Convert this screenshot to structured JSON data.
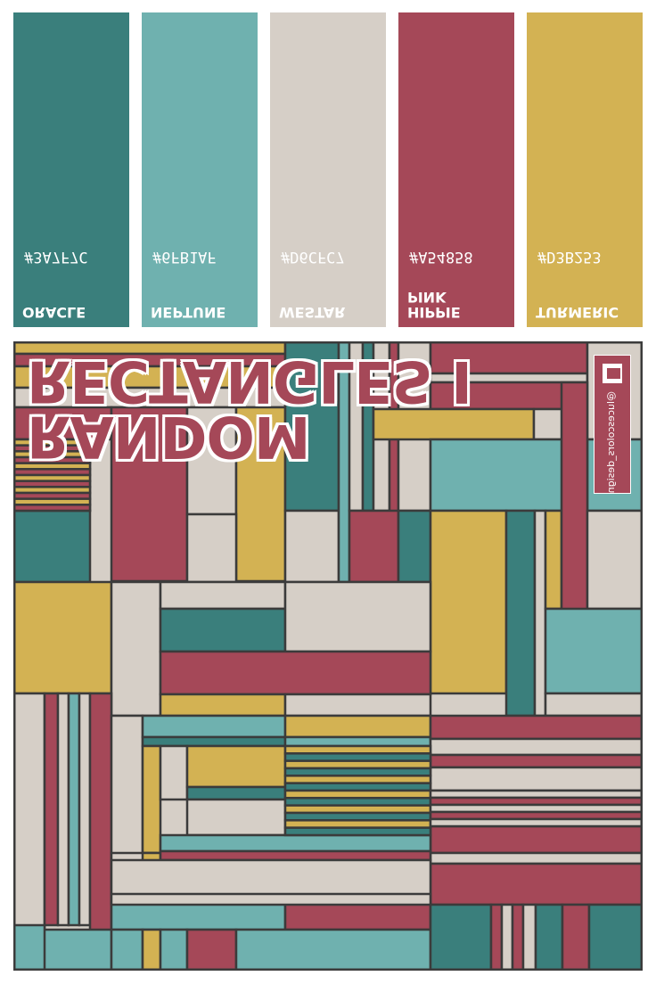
{
  "swatches": [
    {
      "hex": "#3A7F7C",
      "name_lines": [
        "ORACLE"
      ],
      "color": "#3a7f7c"
    },
    {
      "hex": "#6FB1AF",
      "name_lines": [
        "NEPTUNE"
      ],
      "color": "#6fb1af"
    },
    {
      "hex": "#D6CFC7",
      "name_lines": [
        "WESTAR"
      ],
      "color": "#d6cfc7"
    },
    {
      "hex": "#A54858",
      "name_lines": [
        "PINK",
        "HIPPIE"
      ],
      "color": "#a54858"
    },
    {
      "hex": "#D3B253",
      "name_lines": [
        "TURMERIC"
      ],
      "color": "#d3b253"
    }
  ],
  "title": {
    "line1": "RECTANGLES I",
    "line2": "RANDOM",
    "color": "#a54858"
  },
  "credit": {
    "handle": "@lucescolors_design"
  },
  "colors": {
    "teal": "#3a7f7c",
    "aqua": "#6fb1af",
    "beige": "#d6cfc7",
    "red": "#a54858",
    "gold": "#d3b253",
    "line": "#3b3b3b"
  }
}
